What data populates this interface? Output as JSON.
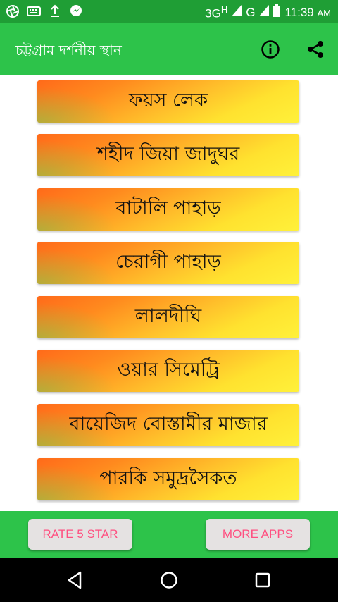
{
  "status_bar": {
    "network": "3G",
    "network_sup": "H",
    "network2": "G",
    "time": "11:39",
    "ampm": "AM"
  },
  "app_bar": {
    "title": "চট্টগ্রাম দর্শনীয় স্থান",
    "info_icon": "info-icon",
    "share_icon": "share-icon"
  },
  "places": [
    {
      "label": "ফয়স লেক"
    },
    {
      "label": "শহীদ জিয়া জাদুঘর"
    },
    {
      "label": "বাটালি পাহাড়"
    },
    {
      "label": "চেরাগী পাহাড়"
    },
    {
      "label": "লালদীঘি"
    },
    {
      "label": "ওয়ার সিমেট্রি"
    },
    {
      "label": "বায়েজিদ বোস্তামীর মাজার"
    },
    {
      "label": "পারকি সমুদ্রসৈকত"
    }
  ],
  "bottom_bar": {
    "rate_label": "RATE 5 STAR",
    "more_label": "MORE APPS"
  },
  "colors": {
    "status_bar": "#1f9e35",
    "app_bar": "#2dc34a",
    "button_text": "#ff4f80",
    "item_orange": "#ff6a1a",
    "item_yellow": "#fff13a"
  }
}
